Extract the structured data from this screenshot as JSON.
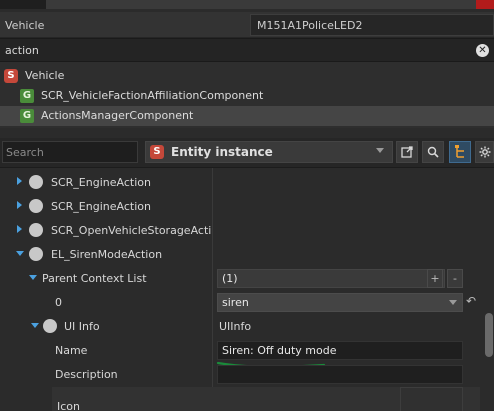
{
  "vehicle_row": {
    "label": "Vehicle",
    "value": "M151A1PoliceLED2"
  },
  "search_row": {
    "text": "action",
    "clear_icon": "close-icon"
  },
  "tree": [
    {
      "label": "Vehicle",
      "badge": "S"
    },
    {
      "label": "SCR_VehicleFactionAffiliationComponent",
      "badge": "G"
    },
    {
      "label": "ActionsManagerComponent",
      "badge": "G",
      "selected": true
    }
  ],
  "toolbar": {
    "search_placeholder": "Search",
    "entity_badge": "S",
    "entity_label": "Entity instance",
    "buttons": [
      "open-external-icon",
      "search-icon",
      "hierarchy-icon",
      "gear-icon"
    ]
  },
  "properties": {
    "action1": "SCR_EngineAction",
    "action2": "SCR_EngineAction",
    "action3": "SCR_OpenVehicleStorageAction",
    "action4": "EL_SirenModeAction",
    "parent_context_label": "Parent Context List",
    "parent_context_value": "(1)",
    "index_label": "0",
    "index_value": "siren",
    "uiinfo_label": "UI Info",
    "uiinfo_value": "UIInfo",
    "name_label": "Name",
    "name_value": "Siren: Off duty mode",
    "description_label": "Description",
    "description_value": "",
    "icon_label": "Icon"
  },
  "colors": {
    "accent": "#4ba1e0",
    "underline": "#1a8a3a",
    "close": "#b21b1b"
  }
}
